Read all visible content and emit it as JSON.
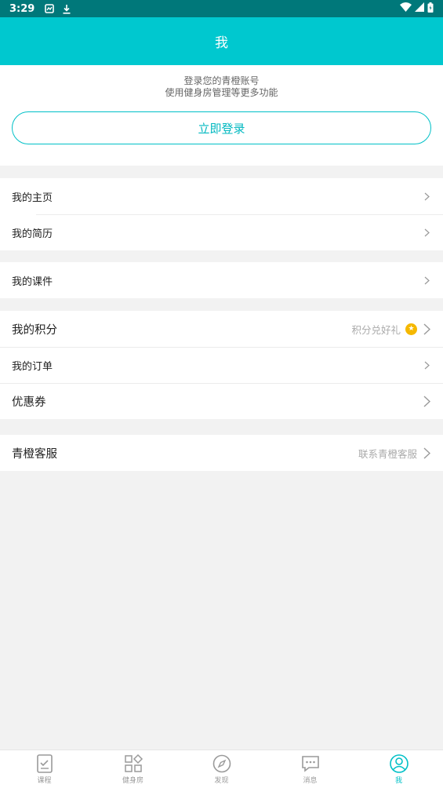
{
  "status_bar": {
    "time": "3:29"
  },
  "header": {
    "title": "我"
  },
  "login": {
    "line1": "登录您的青橙账号",
    "line2": "使用健身房管理等更多功能",
    "button_label": "立即登录"
  },
  "groups": {
    "profile": [
      {
        "label": "我的主页"
      },
      {
        "label": "我的简历"
      }
    ],
    "courseware": [
      {
        "label": "我的课件"
      }
    ],
    "account": [
      {
        "label": "我的积分",
        "sub": "积分兑好礼"
      },
      {
        "label": "我的订单"
      },
      {
        "label": "优惠券"
      }
    ],
    "service": [
      {
        "label": "青橙客服",
        "sub": "联系青橙客服"
      }
    ]
  },
  "bottom_nav": [
    {
      "label": "课程",
      "icon": "course-icon"
    },
    {
      "label": "健身房",
      "icon": "gym-icon"
    },
    {
      "label": "发现",
      "icon": "compass-icon"
    },
    {
      "label": "消息",
      "icon": "message-icon"
    },
    {
      "label": "我",
      "icon": "profile-icon",
      "active": true
    }
  ],
  "colors": {
    "accent": "#00c8cf",
    "status_bar": "#00787a",
    "coin": "#f5b800"
  }
}
